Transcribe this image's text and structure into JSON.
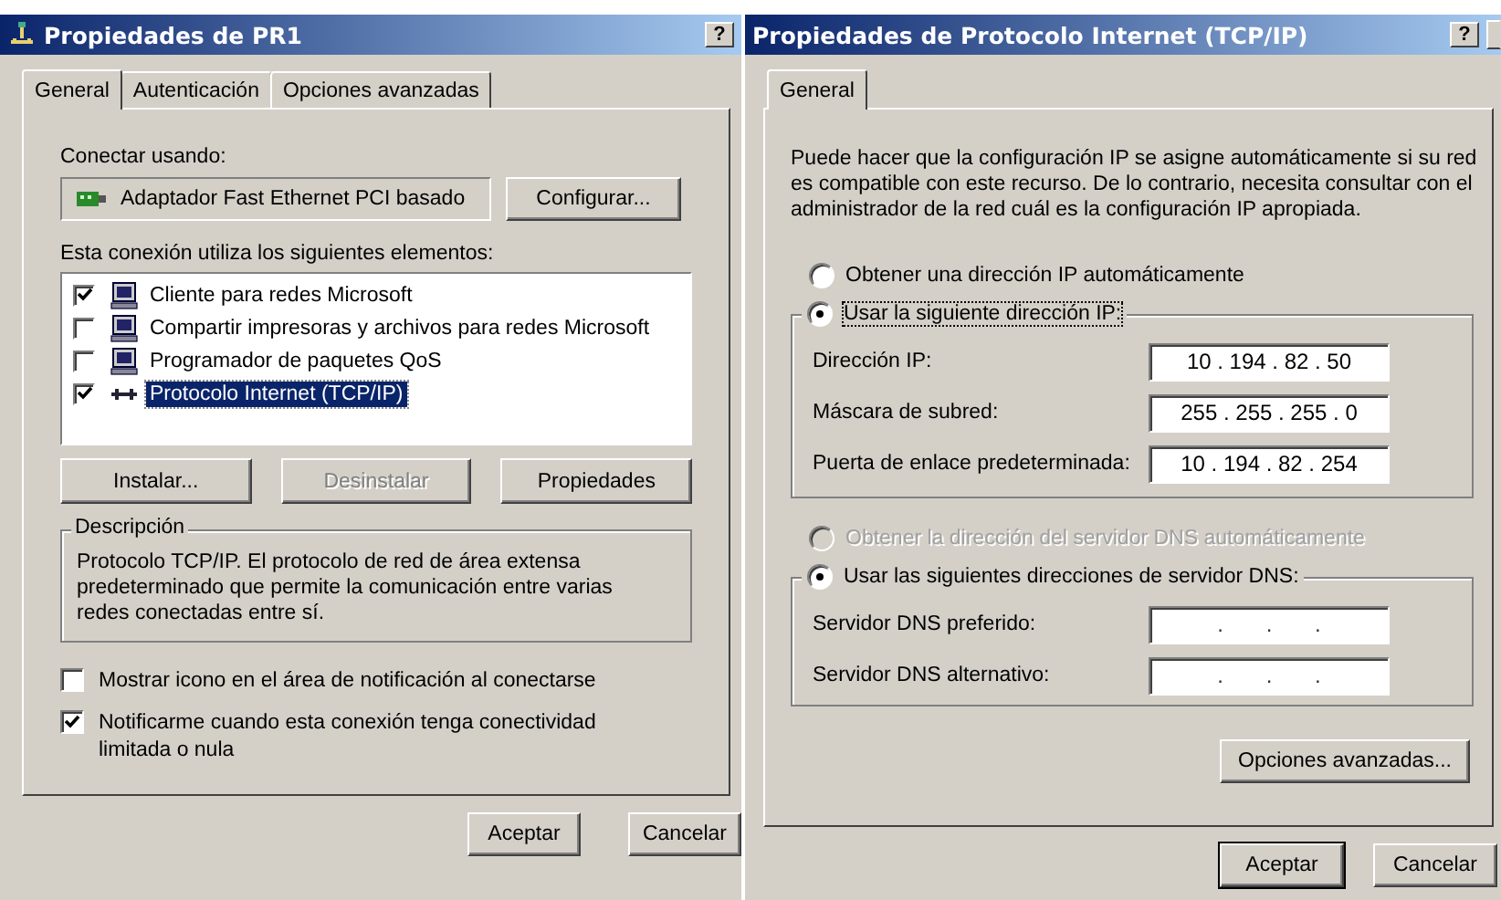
{
  "left": {
    "title": "Propiedades de PR1",
    "help": "?",
    "tabs": [
      {
        "label": "General",
        "selected": true
      },
      {
        "label": "Autenticación",
        "selected": false
      },
      {
        "label": "Opciones avanzadas",
        "selected": false
      }
    ],
    "connect_label": "Conectar usando:",
    "adapter": "Adaptador Fast Ethernet PCI basado",
    "configure_button": "Configurar...",
    "components_label": "Esta conexión utiliza los siguientes elementos:",
    "components": [
      {
        "label": "Cliente para redes Microsoft",
        "checked": true,
        "selected": false,
        "kind": "computer"
      },
      {
        "label": "Compartir impresoras y archivos para redes Microsoft",
        "checked": false,
        "selected": false,
        "kind": "computer"
      },
      {
        "label": "Programador de paquetes QoS",
        "checked": false,
        "selected": false,
        "kind": "computer"
      },
      {
        "label": "Protocolo Internet (TCP/IP)",
        "checked": true,
        "selected": true,
        "kind": "protocol"
      }
    ],
    "actions": [
      {
        "label": "Instalar...",
        "disabled": false
      },
      {
        "label": "Desinstalar",
        "disabled": true
      },
      {
        "label": "Propiedades",
        "disabled": false
      }
    ],
    "description": {
      "legend": "Descripción",
      "text": "Protocolo TCP/IP. El protocolo de red de área extensa predeterminado que permite la comunicación entre varias redes conectadas entre sí."
    },
    "options": [
      {
        "label": "Mostrar icono en el área de notificación al conectarse",
        "checked": false
      },
      {
        "label": "Notificarme cuando esta conexión tenga conectividad limitada o nula",
        "checked": true
      }
    ],
    "buttons": [
      "Aceptar",
      "Cancelar"
    ]
  },
  "right": {
    "title": "Propiedades de Protocolo Internet (TCP/IP)",
    "help": "?",
    "tabs": [
      {
        "label": "General",
        "selected": true
      }
    ],
    "intro": "Puede hacer que la configuración IP se asigne automáticamente si su red es compatible con este recurso. De lo contrario, necesita consultar con el administrador de la red cuál es la configuración IP apropiada.",
    "ip_auto": {
      "label": "Obtener una dirección IP automáticamente",
      "selected": false,
      "disabled": false
    },
    "ip_manual": {
      "label": "Usar la siguiente dirección IP:",
      "selected": true,
      "disabled": false
    },
    "ip_fields": [
      {
        "label": "Dirección IP:",
        "value": "10 . 194 . 82 . 50"
      },
      {
        "label": "Máscara de subred:",
        "value": "255 . 255 . 255 . 0"
      },
      {
        "label": "Puerta de enlace predeterminada:",
        "value": "10 . 194 . 82 . 254"
      }
    ],
    "dns_auto": {
      "label": "Obtener la dirección del servidor DNS automáticamente",
      "selected": false,
      "disabled": true
    },
    "dns_manual": {
      "label": "Usar las siguientes direcciones de servidor DNS:",
      "selected": true,
      "disabled": false
    },
    "dns_fields": [
      {
        "label": "Servidor DNS preferido:",
        "value": ".       .       ."
      },
      {
        "label": "Servidor DNS alternativo:",
        "value": ".       .       ."
      }
    ],
    "advanced_button": "Opciones avanzadas...",
    "buttons": [
      "Aceptar",
      "Cancelar"
    ]
  }
}
